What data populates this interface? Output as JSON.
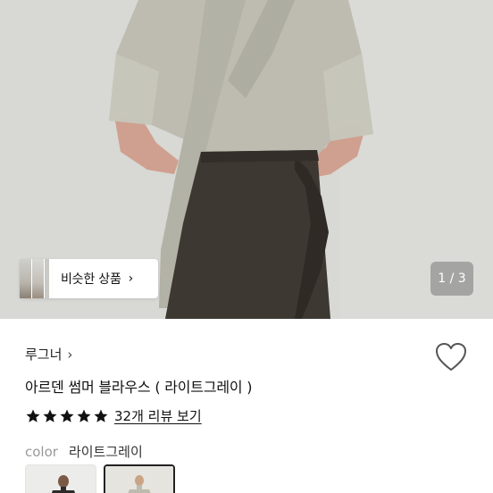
{
  "gallery": {
    "similar_label": "비슷한 상품",
    "similar_chevron": "›",
    "pager": "1 / 3"
  },
  "product": {
    "brand": "루그너",
    "brand_chevron": "›",
    "title": "아르덴 썸머 블라우스 ( 라이트그레이 )",
    "rating": 5,
    "review_link": "32개 리뷰 보기",
    "color_label": "color",
    "color_value": "라이트그레이",
    "swatch_count": 2,
    "selected_swatch": 2
  },
  "icons": {
    "heart": "heart-icon",
    "star": "star-icon"
  },
  "colors": {
    "blouse": "#bdbbae",
    "skirt": "#3d3832",
    "skin": "#cfa08f",
    "star": "#111111"
  }
}
